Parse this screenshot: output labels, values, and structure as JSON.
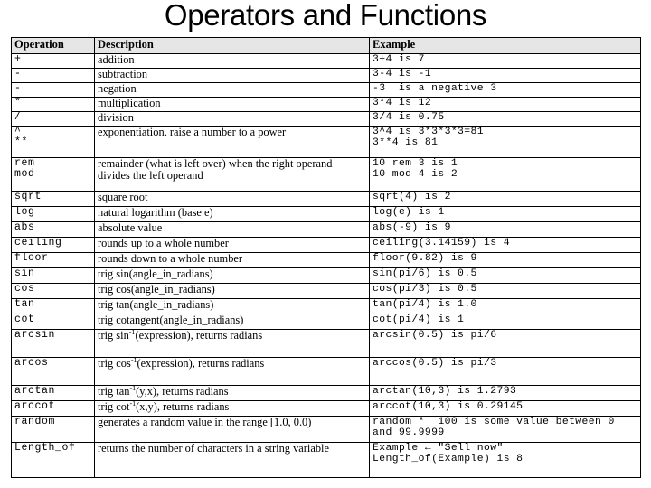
{
  "slide": {
    "title": "Operators and Functions",
    "background_color": "#ffffff",
    "text_color": "#000000",
    "header_fill": "#e6e6e6",
    "border_color": "#000000"
  },
  "table": {
    "columns": [
      "Operation",
      "Description",
      "Example"
    ],
    "rows": [
      {
        "operation": "+",
        "description": "addition",
        "example": "3+4 is 7"
      },
      {
        "operation": "-",
        "description": "subtraction",
        "example": "3-4 is -1"
      },
      {
        "operation": "-",
        "description": "negation",
        "example": "-3  is a negative 3"
      },
      {
        "operation": "*",
        "description": "multiplication",
        "example": "3*4 is 12"
      },
      {
        "operation": "/",
        "description": "division",
        "example": "3/4 is 0.75"
      },
      {
        "operation": "^\n**",
        "description": "exponentiation, raise a number to a power",
        "example": "3^4 is 3*3*3*3=81\n3**4 is 81"
      },
      {
        "operation": "rem\nmod",
        "description": "remainder (what is left over) when the right operand divides the left operand",
        "example": "10 rem 3 is 1\n10 mod 4 is 2"
      },
      {
        "operation": "sqrt",
        "description": "square root",
        "example": "sqrt(4) is 2"
      },
      {
        "operation": "log",
        "description": "natural logarithm (base e)",
        "example": "log(e) is 1"
      },
      {
        "operation": "abs",
        "description": "absolute value",
        "example": "abs(-9) is 9"
      },
      {
        "operation": "ceiling",
        "description": "rounds up to a whole number",
        "example": "ceiling(3.14159) is 4"
      },
      {
        "operation": "floor",
        "description": "rounds down to a whole number",
        "example": "floor(9.82) is 9"
      },
      {
        "operation": "sin",
        "description": "trig sin(angle_in_radians)",
        "example": "sin(pi/6) is 0.5"
      },
      {
        "operation": "cos",
        "description": "trig cos(angle_in_radians)",
        "example": "cos(pi/3) is 0.5"
      },
      {
        "operation": "tan",
        "description": "trig tan(angle_in_radians)",
        "example": "tan(pi/4) is 1.0"
      },
      {
        "operation": "cot",
        "description": "trig cotangent(angle_in_radians)",
        "example": "cot(pi/4) is 1"
      },
      {
        "operation": "arcsin",
        "description_prefix": "trig sin",
        "description_sup": "-1",
        "description_suffix": "(expression), returns radians",
        "example": "arcsin(0.5) is pi/6"
      },
      {
        "operation": "arcos",
        "description_prefix": "trig cos",
        "description_sup": "-1",
        "description_suffix": "(expression), returns radians",
        "example": "arccos(0.5) is pi/3"
      },
      {
        "operation": "arctan",
        "description_prefix": "trig tan",
        "description_sup": "-1",
        "description_suffix": "(y,x), returns radians",
        "example": "arctan(10,3) is 1.2793"
      },
      {
        "operation": "arccot",
        "description_prefix": "trig cot",
        "description_sup": "-1",
        "description_suffix": "(x,y), returns radians",
        "example": "arccot(10,3) is 0.29145"
      },
      {
        "operation": "random",
        "description": "generates a random value in the range [1.0, 0.0)",
        "example": "random *  100 is some value between 0 and 99.9999"
      },
      {
        "operation": "Length_of",
        "description": "returns the number of characters in a string variable",
        "example": "Example ← \"Sell now\"\nLength_of(Example) is 8"
      }
    ]
  }
}
